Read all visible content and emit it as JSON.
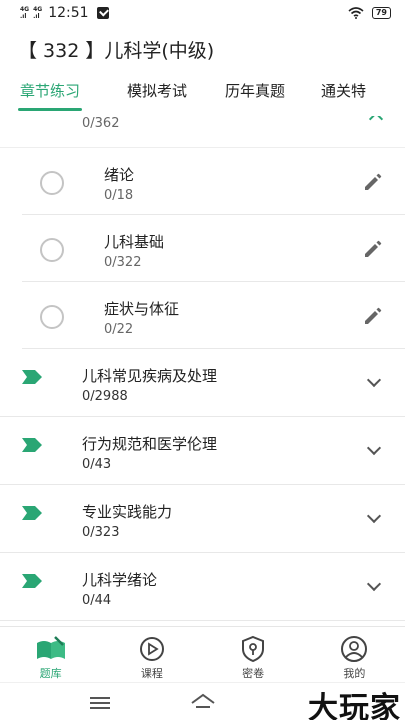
{
  "status_bar": {
    "net1": "4G⁺",
    "net2": "4G HD",
    "time": "12:51",
    "battery": "79"
  },
  "header": {
    "title": "【 332 】儿科学(中级)"
  },
  "tabs": [
    {
      "label": "章节练习",
      "active": true
    },
    {
      "label": "模拟考试",
      "active": false
    },
    {
      "label": "历年真题",
      "active": false
    },
    {
      "label": "通关特",
      "active": false
    }
  ],
  "partial_row": {
    "count": "0/362"
  },
  "sub_chapters": [
    {
      "name": "绪论",
      "count": "0/18",
      "icon": "edit-icon"
    },
    {
      "name": "儿科基础",
      "count": "0/322",
      "icon": "edit-icon"
    },
    {
      "name": "症状与体征",
      "count": "0/22",
      "icon": "edit-icon"
    }
  ],
  "chapters": [
    {
      "name": "儿科常见疾病及处理",
      "count": "0/2988"
    },
    {
      "name": "行为规范和医学伦理",
      "count": "0/43"
    },
    {
      "name": "专业实践能力",
      "count": "0/323"
    },
    {
      "name": "儿科学绪论",
      "count": "0/44"
    }
  ],
  "bottom_nav": [
    {
      "label": "题库",
      "icon": "book-icon",
      "active": true
    },
    {
      "label": "课程",
      "icon": "play-icon",
      "active": false
    },
    {
      "label": "密卷",
      "icon": "lock-shield-icon",
      "active": false
    },
    {
      "label": "我的",
      "icon": "user-icon",
      "active": false
    }
  ],
  "watermark": "大玩家",
  "colors": {
    "accent": "#2aa674",
    "text": "#222222",
    "muted": "#666666"
  }
}
